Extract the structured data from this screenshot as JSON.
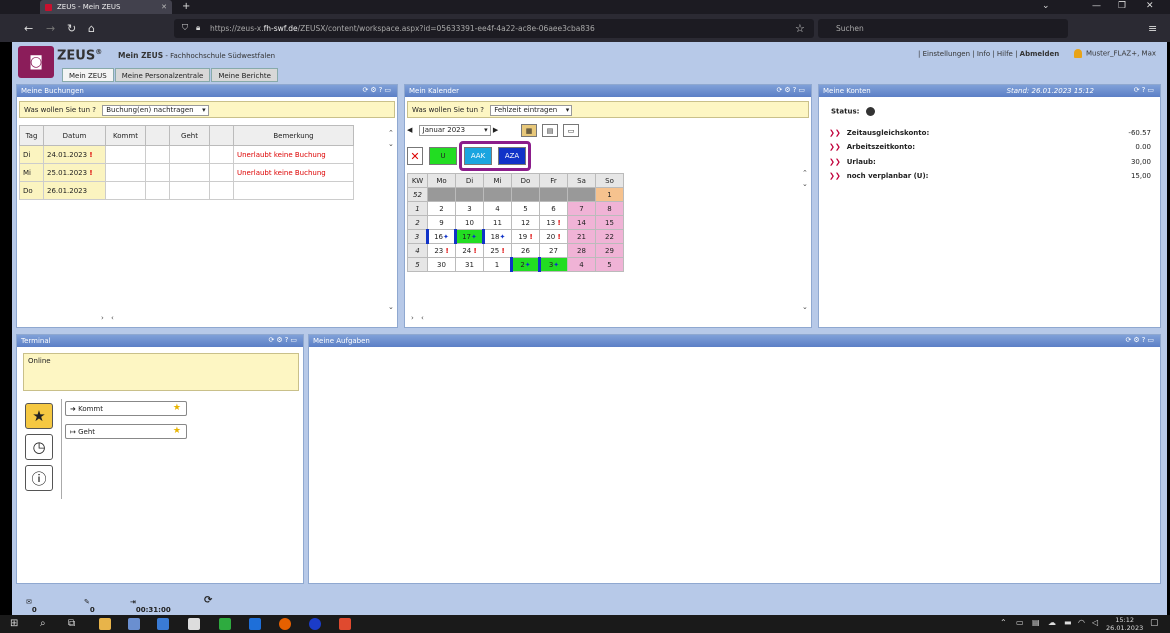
{
  "browser": {
    "tab_title": "ZEUS - Mein ZEUS",
    "new_tab": "+",
    "url_prefix": "https://zeus-x.",
    "url_host": "fh-swf.de",
    "url_rest": "/ZEUSX/content/workspace.aspx?id=05633391-ee4f-4a22-ac8e-06aee3cba836",
    "search_placeholder": "Suchen"
  },
  "header": {
    "brand": "ZEUS",
    "brand_mark": "®",
    "title": "Mein ZEUS",
    "org": "- Fachhochschule Südwestfalen",
    "links": [
      "Einstellungen",
      "Info",
      "Hilfe",
      "Abmelden"
    ],
    "user": "Muster_FLAZ+, Max",
    "tabs": [
      "Mein ZEUS",
      "Meine Personalzentrale",
      "Meine Berichte"
    ]
  },
  "buchungen": {
    "title": "Meine Buchungen",
    "question": "Was wollen Sie tun ?",
    "select": "Buchung(en) nachtragen",
    "columns": [
      "Tag",
      "Datum",
      "Kommt",
      "",
      "Geht",
      "",
      "Bemerkung"
    ],
    "rows": [
      {
        "tag": "Di",
        "datum": "24.01.2023",
        "flag": "!",
        "bemerkung": "Unerlaubt keine Buchung"
      },
      {
        "tag": "Mi",
        "datum": "25.01.2023",
        "flag": "!",
        "bemerkung": "Unerlaubt keine Buchung"
      },
      {
        "tag": "Do",
        "datum": "26.01.2023",
        "flag": "",
        "bemerkung": ""
      }
    ]
  },
  "kalender": {
    "title": "Mein Kalender",
    "question": "Was wollen Sie tun ?",
    "select": "Fehlzeit eintragen",
    "month": "Januar 2023",
    "buttons": [
      "U",
      "AAK",
      "AZA"
    ],
    "weekdays": [
      "KW",
      "Mo",
      "Di",
      "Mi",
      "Do",
      "Fr",
      "Sa",
      "So"
    ],
    "weeks": [
      {
        "kw": "52",
        "days": [
          "",
          "",
          "",
          "",
          "",
          "",
          "1"
        ]
      },
      {
        "kw": "1",
        "days": [
          "2",
          "3",
          "4",
          "5",
          "6",
          "7",
          "8"
        ]
      },
      {
        "kw": "2",
        "days": [
          "9",
          "10",
          "11",
          "12",
          "13",
          "14",
          "15"
        ]
      },
      {
        "kw": "3",
        "days": [
          "16",
          "17",
          "18",
          "19",
          "20",
          "21",
          "22"
        ]
      },
      {
        "kw": "4",
        "days": [
          "23",
          "24",
          "25",
          "26",
          "27",
          "28",
          "29"
        ]
      },
      {
        "kw": "5",
        "days": [
          "30",
          "31",
          "1",
          "2",
          "3",
          "4",
          "5"
        ]
      }
    ]
  },
  "konten": {
    "title": "Meine Konten",
    "stand": "Stand: 26.01.2023 15:12",
    "status_label": "Status:",
    "items": [
      {
        "label": "Zeitausgleichskonto:",
        "value": "-60.57"
      },
      {
        "label": "Arbeitszeitkonto:",
        "value": "0.00"
      },
      {
        "label": "Urlaub:",
        "value": "30,00"
      },
      {
        "label": "noch verplanbar (U):",
        "value": "15,00"
      }
    ]
  },
  "terminal": {
    "title": "Terminal",
    "status": "Online",
    "kommt": "Kommt",
    "geht": "Geht"
  },
  "aufgaben": {
    "title": "Meine Aufgaben"
  },
  "statusbar": {
    "mail": "0 / 0",
    "edit": "0",
    "time": "00:31:00"
  },
  "taskbar": {
    "time": "15:12",
    "date": "26.01.2023"
  }
}
